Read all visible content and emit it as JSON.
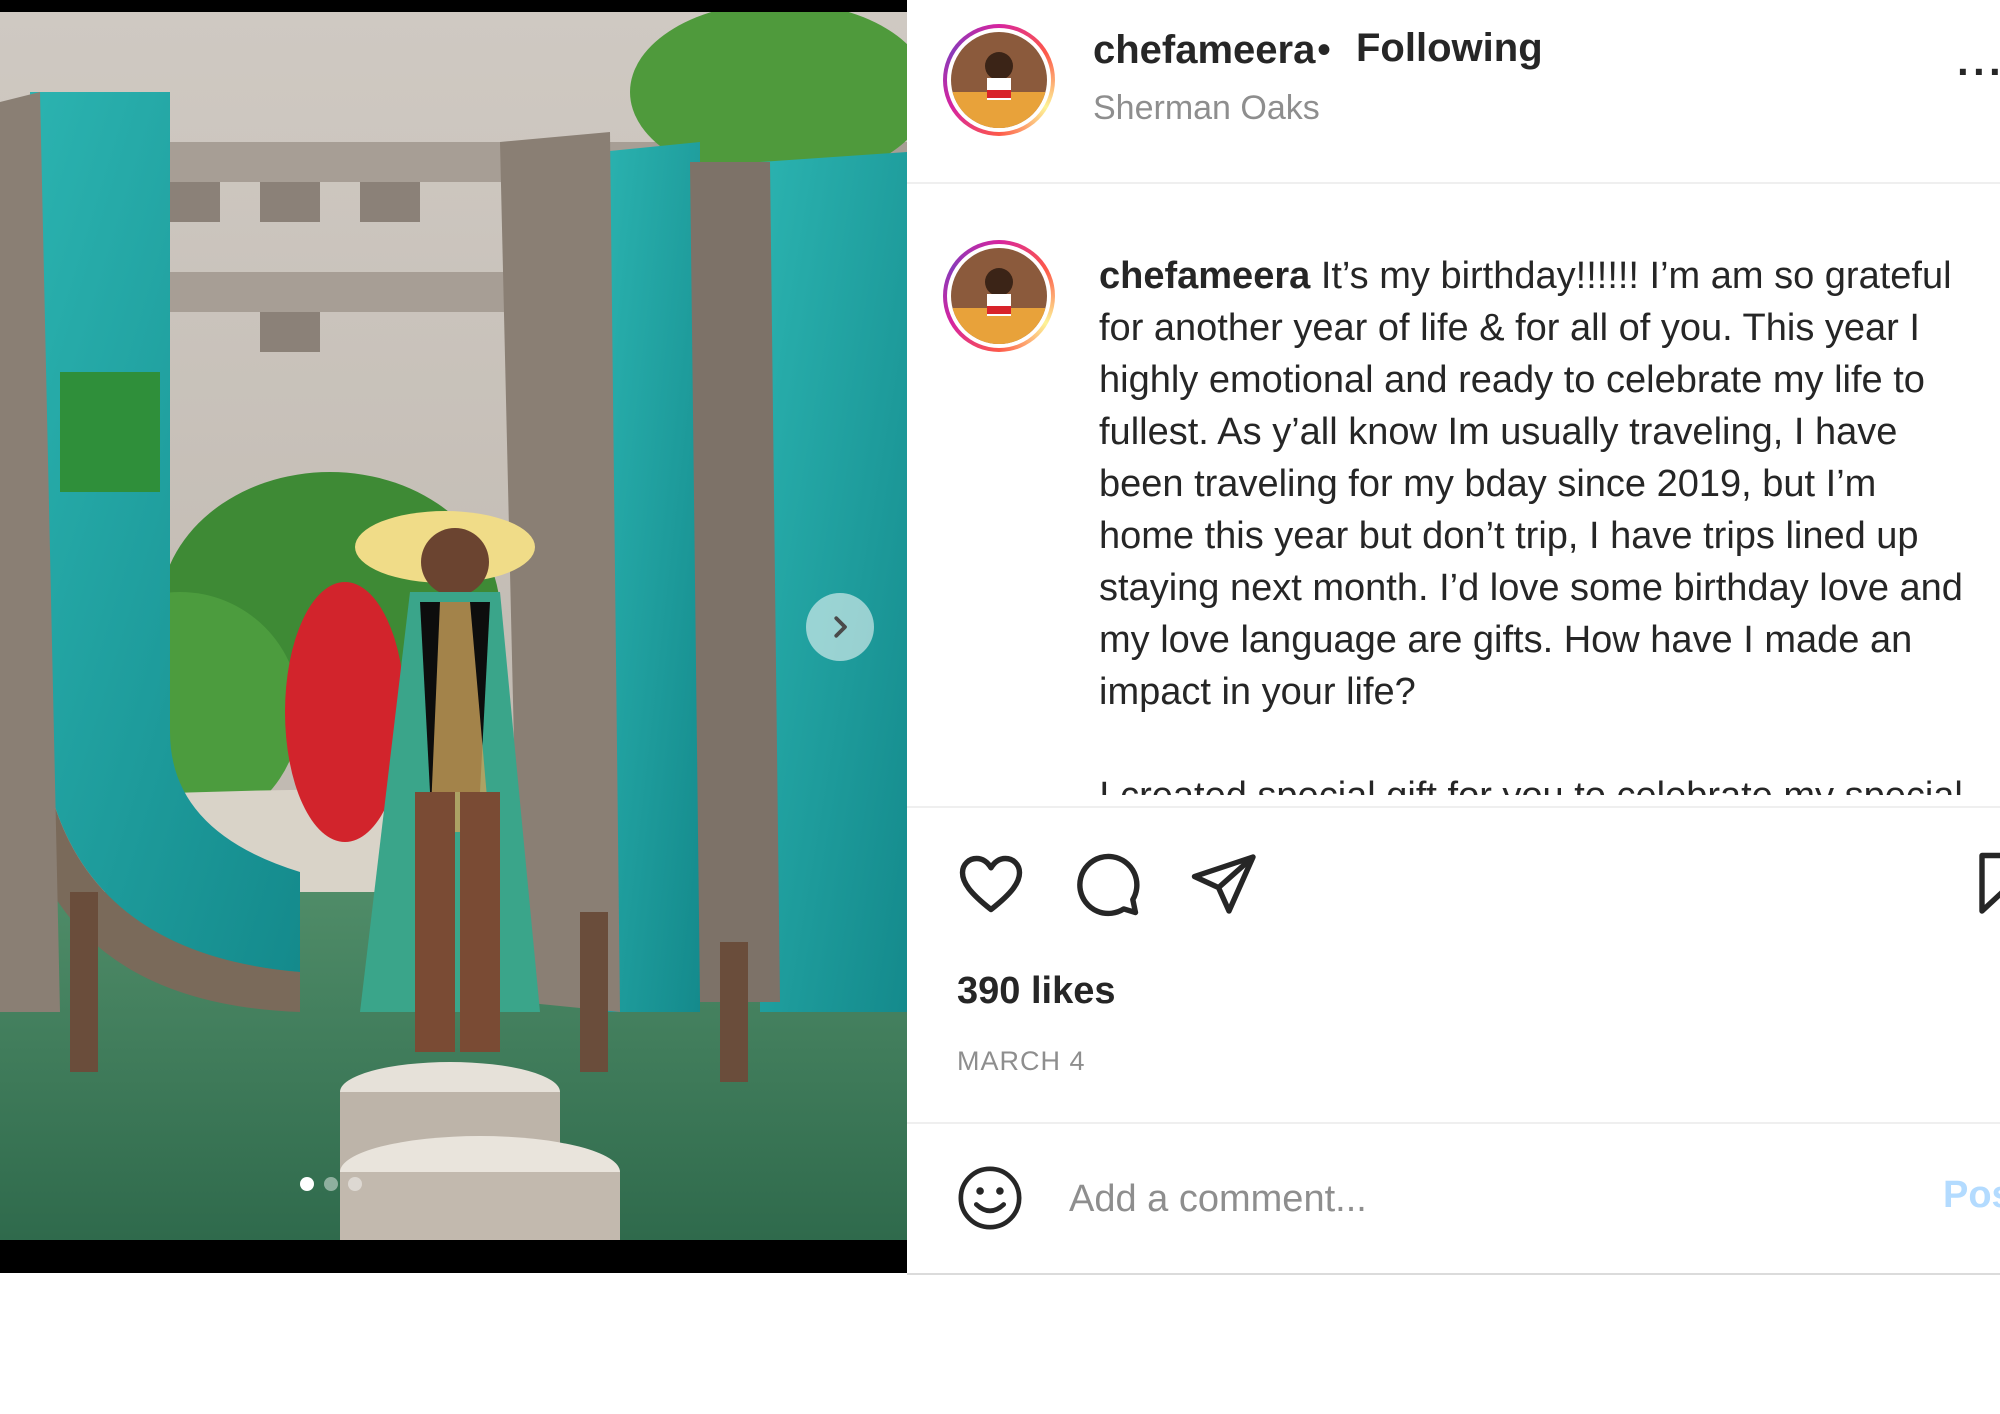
{
  "post": {
    "username": "chefameera",
    "follow_separator": "•",
    "follow_status": "Following",
    "location": "Sherman Oaks",
    "more_label": "···"
  },
  "caption": {
    "username": "chefameera",
    "lines": [
      "It’s my birthday!!!!!! I’m am so grateful",
      "for another year of life & for all of you. This year I",
      "highly emotional and ready to celebrate my life to",
      "fullest. As y’all know Im usually traveling, I have",
      "been traveling for my bday since 2019, but I’m",
      "home this year but don’t trip, I have trips lined up",
      "staying next month. I’d love some birthday love and",
      "my love language are gifts. How have I made an",
      "impact in your life?"
    ],
    "cut_line": "I created special gift for you to celebrate my special"
  },
  "engagement": {
    "likes": "390 likes",
    "date": "MARCH 4"
  },
  "comment": {
    "placeholder": "Add a comment...",
    "post_label": "Post"
  },
  "carousel": {
    "slide_count": 3,
    "active_index": 0
  },
  "icons": {
    "like": "heart-icon",
    "comment": "speech-bubble-icon",
    "share": "paper-plane-icon",
    "save": "bookmark-icon",
    "emoji": "smiley-icon",
    "next": "chevron-right-icon"
  },
  "colors": {
    "text": "#262626",
    "muted": "#8e8e8e",
    "post_button_disabled": "#b3dbff",
    "story_ring": "#d6249f"
  }
}
